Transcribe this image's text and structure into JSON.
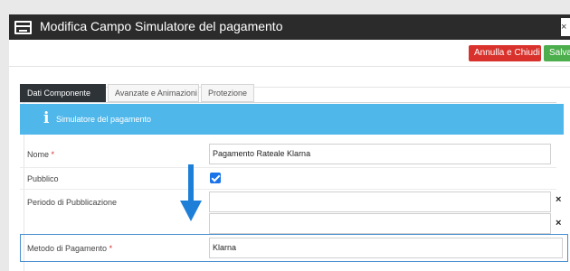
{
  "window": {
    "title": "Modifica Campo Simulatore del pagamento",
    "close_label": "×"
  },
  "toolbar": {
    "cancel_label": "Annulla e Chiudi",
    "save_label": "Salva"
  },
  "tabs": [
    {
      "label": "Dati Componente",
      "active": true
    },
    {
      "label": "Avanzate e Animazioni",
      "active": false
    },
    {
      "label": "Protezione",
      "active": false
    }
  ],
  "info_banner": {
    "icon": "info-icon",
    "text": "Simulatore del pagamento"
  },
  "form": {
    "nome": {
      "label": "Nome",
      "required": "*",
      "value": "Pagamento Rateale Klarna"
    },
    "pubblico": {
      "label": "Pubblico",
      "checked": true
    },
    "periodo": {
      "label": "Periodo di Pubblicazione",
      "value_start": "",
      "value_end": "",
      "clear_label": "×"
    },
    "metodo": {
      "label": "Metodo di Pagamento",
      "required": "*",
      "value": "Klarna"
    }
  },
  "colors": {
    "titlebar": "#2b2b2b",
    "cancel": "#d9322c",
    "save": "#4cae4c",
    "info": "#4fb7ea",
    "checkbox": "#1a73e8",
    "arrow": "#1e7fd8"
  }
}
